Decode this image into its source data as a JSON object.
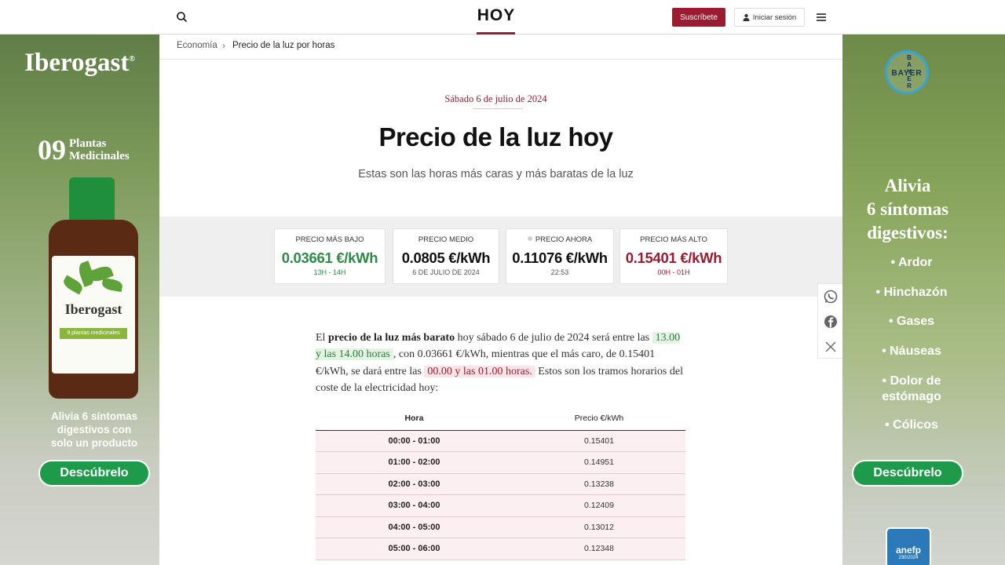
{
  "header": {
    "logo": "HOY",
    "subscribe_label": "Suscríbete",
    "login_label": "Iniciar sesión",
    "search_icon": "search-icon",
    "menu_icon": "hamburger-menu-icon"
  },
  "breadcrumb": {
    "section": "Economía",
    "separator": "›",
    "current": "Precio de la luz por horas"
  },
  "article_head": {
    "date": "Sábado 6 de julio de 2024",
    "title": "Precio de la luz hoy",
    "subtitle": "Estas son las horas más caras y más baratas de la luz"
  },
  "stats": [
    {
      "label": "PRECIO MÁS BAJO",
      "value": "0.03661 €/kWh",
      "sub": "13H - 14H",
      "color": "#2e8b47"
    },
    {
      "label": "PRECIO MEDIO",
      "value": "0.0805 €/kWh",
      "sub": "6 DE JULIO DE 2024",
      "color": "#111111"
    },
    {
      "label": "PRECIO AHORA",
      "value": "0.11076 €/kWh",
      "sub": "22:53",
      "color": "#111111"
    },
    {
      "label": "PRECIO MÁS ALTO",
      "value": "0.15401 €/kWh",
      "sub": "00H - 01H",
      "color": "#9b1b30"
    }
  ],
  "body": {
    "p_intro_1": "El ",
    "p_bold": "precio de la luz más barato",
    "p_intro_2": " hoy sábado 6 de julio de 2024 será entre las ",
    "p_cheap_range": "13.00 y las 14.00 horas",
    "p_mid": ", con 0.03661 €/kWh, mientras que el más caro, de 0.15401 €/kWh, se dará entre las ",
    "p_expensive_range": "00.00 y las 01.00 horas.",
    "p_end": " Estos son los tramos horarios del coste de la electricidad hoy:"
  },
  "table": {
    "headers": {
      "hour": "Hora",
      "price": "Precio €/kWh"
    },
    "rows": [
      {
        "hour": "00:00 - 01:00",
        "price": "0.15401"
      },
      {
        "hour": "01:00 - 02:00",
        "price": "0.14951"
      },
      {
        "hour": "02:00 - 03:00",
        "price": "0.13238"
      },
      {
        "hour": "03:00 - 04:00",
        "price": "0.12409"
      },
      {
        "hour": "04:00 - 05:00",
        "price": "0.13012"
      },
      {
        "hour": "05:00 - 06:00",
        "price": "0.12348"
      }
    ]
  },
  "share": {
    "icons": [
      "whatsapp-icon",
      "facebook-icon",
      "x-twitter-icon"
    ]
  },
  "ad_left": {
    "brand": "Iberogast",
    "registered": "®",
    "plants_number": "09",
    "plants_line1": "Plantas",
    "plants_line2": "Medicinales",
    "bottle_name": "Iberogast",
    "bottle_tag": "9 plantas medicinales",
    "copy_line1": "Alivia 6 síntomas",
    "copy_line2": "digestivos con",
    "copy_line3": "solo un producto",
    "cta": "Descúbrelo"
  },
  "ad_right": {
    "logo": "BAYER",
    "head_line1": "Alivia",
    "head_line2": "6 síntomas",
    "head_line3": "digestivos:",
    "symptoms": [
      "• Ardor",
      "• Hinchazón",
      "• Gases",
      "• Náuseas",
      "• Dolor de estómago",
      "• Cólicos"
    ],
    "cta": "Descúbrelo",
    "badge": "anefp",
    "badge_sub": "230/2024"
  }
}
